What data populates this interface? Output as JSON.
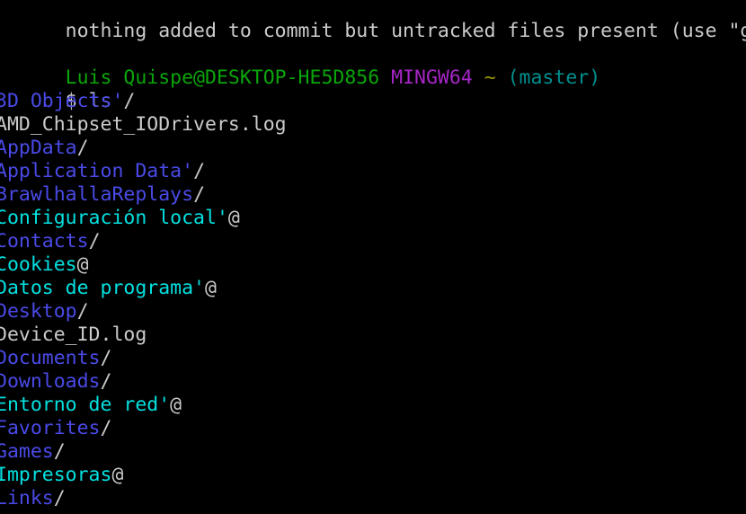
{
  "terminal": {
    "app": "MINGW64 Git Bash",
    "background_color": "#000000",
    "colors": {
      "default_text": "#cbcbcb",
      "user_host_green": "#0aa60a",
      "shell_purple": "#a626c6",
      "path_olive": "#9a9a00",
      "branch_teal": "#008f8f",
      "directory_blue": "#4a4ae8",
      "symlink_cyan": "#00e0e0",
      "suffix_gray": "#c9c9c9"
    },
    "scrollback": {
      "git_status_tail": "nothing added to commit but untracked files present (use \"gi"
    },
    "prompt": {
      "user_host": "Luis Quispe@DESKTOP-HE5D856",
      "shell": "MINGW64",
      "cwd": "~",
      "branch": "(master)",
      "sigil": "$",
      "command": "ls"
    },
    "listing": {
      "entries": [
        {
          "name": "3D Objects'",
          "suffix": "/",
          "type": "directory"
        },
        {
          "name": "AMD_Chipset_IODrivers.log",
          "suffix": "",
          "type": "file"
        },
        {
          "name": "AppData",
          "suffix": "/",
          "type": "directory"
        },
        {
          "name": "Application Data'",
          "suffix": "/",
          "type": "directory"
        },
        {
          "name": "BrawlhallaReplays",
          "suffix": "/",
          "type": "directory"
        },
        {
          "name": "Configuración local'",
          "suffix": "@",
          "type": "symlink"
        },
        {
          "name": "Contacts",
          "suffix": "/",
          "type": "directory"
        },
        {
          "name": "Cookies",
          "suffix": "@",
          "type": "symlink"
        },
        {
          "name": "Datos de programa'",
          "suffix": "@",
          "type": "symlink"
        },
        {
          "name": "Desktop",
          "suffix": "/",
          "type": "directory"
        },
        {
          "name": "Device_ID.log",
          "suffix": "",
          "type": "file"
        },
        {
          "name": "Documents",
          "suffix": "/",
          "type": "directory"
        },
        {
          "name": "Downloads",
          "suffix": "/",
          "type": "directory"
        },
        {
          "name": "Entorno de red'",
          "suffix": "@",
          "type": "symlink"
        },
        {
          "name": "Favorites",
          "suffix": "/",
          "type": "directory"
        },
        {
          "name": "Games",
          "suffix": "/",
          "type": "directory"
        },
        {
          "name": "Impresoras",
          "suffix": "@",
          "type": "symlink"
        },
        {
          "name": "Links",
          "suffix": "/",
          "type": "directory"
        }
      ]
    }
  }
}
